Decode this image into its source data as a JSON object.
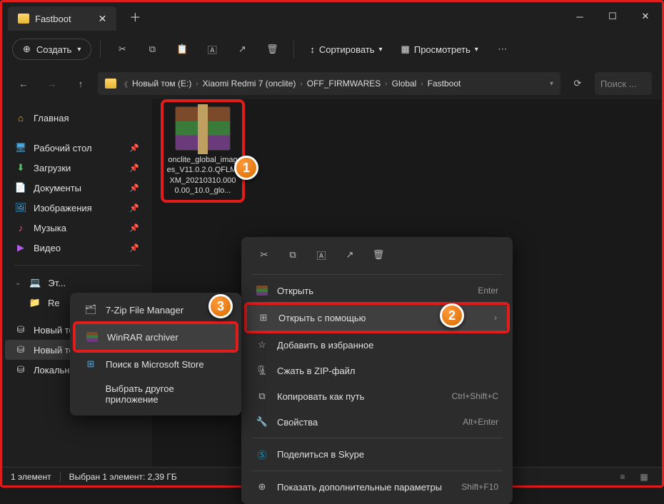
{
  "titlebar": {
    "tab_title": "Fastboot"
  },
  "toolbar": {
    "create": "Создать",
    "sort": "Сортировать",
    "view": "Просмотреть"
  },
  "breadcrumb": [
    "Новый том (E:)",
    "Xiaomi Redmi 7 (onclite)",
    "OFF_FIRMWARES",
    "Global",
    "Fastboot"
  ],
  "search_placeholder": "Поиск ...",
  "sidebar": {
    "home": "Главная",
    "quick": [
      {
        "icon": "ic-desk",
        "label": "Рабочий стол"
      },
      {
        "icon": "ic-down",
        "label": "Загрузки"
      },
      {
        "icon": "ic-doc",
        "label": "Документы"
      },
      {
        "icon": "ic-img",
        "label": "Изображения"
      },
      {
        "icon": "ic-mus",
        "label": "Музыка"
      },
      {
        "icon": "ic-vid",
        "label": "Видео"
      }
    ],
    "pc": "Эт...",
    "pc_child": "Re",
    "drives": [
      "Новый том (D:)",
      "Новый том (E:)",
      "Локальный диск (F:)"
    ]
  },
  "file": {
    "name": "onclite_global_images_V11.0.2.0.QFLMIXM_20210310.0000.00_10.0_glo..."
  },
  "ctx_main": {
    "open": "Открыть",
    "open_short": "Enter",
    "open_with": "Открыть с помощью",
    "fav": "Добавить в избранное",
    "zip": "Сжать в ZIP-файл",
    "copy_path": "Копировать как путь",
    "copy_short": "Ctrl+Shift+C",
    "props": "Свойства",
    "props_short": "Alt+Enter",
    "skype": "Поделиться в Skype",
    "more": "Показать дополнительные параметры",
    "more_short": "Shift+F10"
  },
  "ctx_sub": {
    "sevenzip": "7-Zip File Manager",
    "winrar": "WinRAR archiver",
    "store": "Поиск в Microsoft Store",
    "other": "Выбрать другое приложение"
  },
  "status": {
    "count": "1 элемент",
    "selected": "Выбран 1 элемент: 2,39 ГБ"
  },
  "badges": {
    "b1": "1",
    "b2": "2",
    "b3": "3"
  }
}
